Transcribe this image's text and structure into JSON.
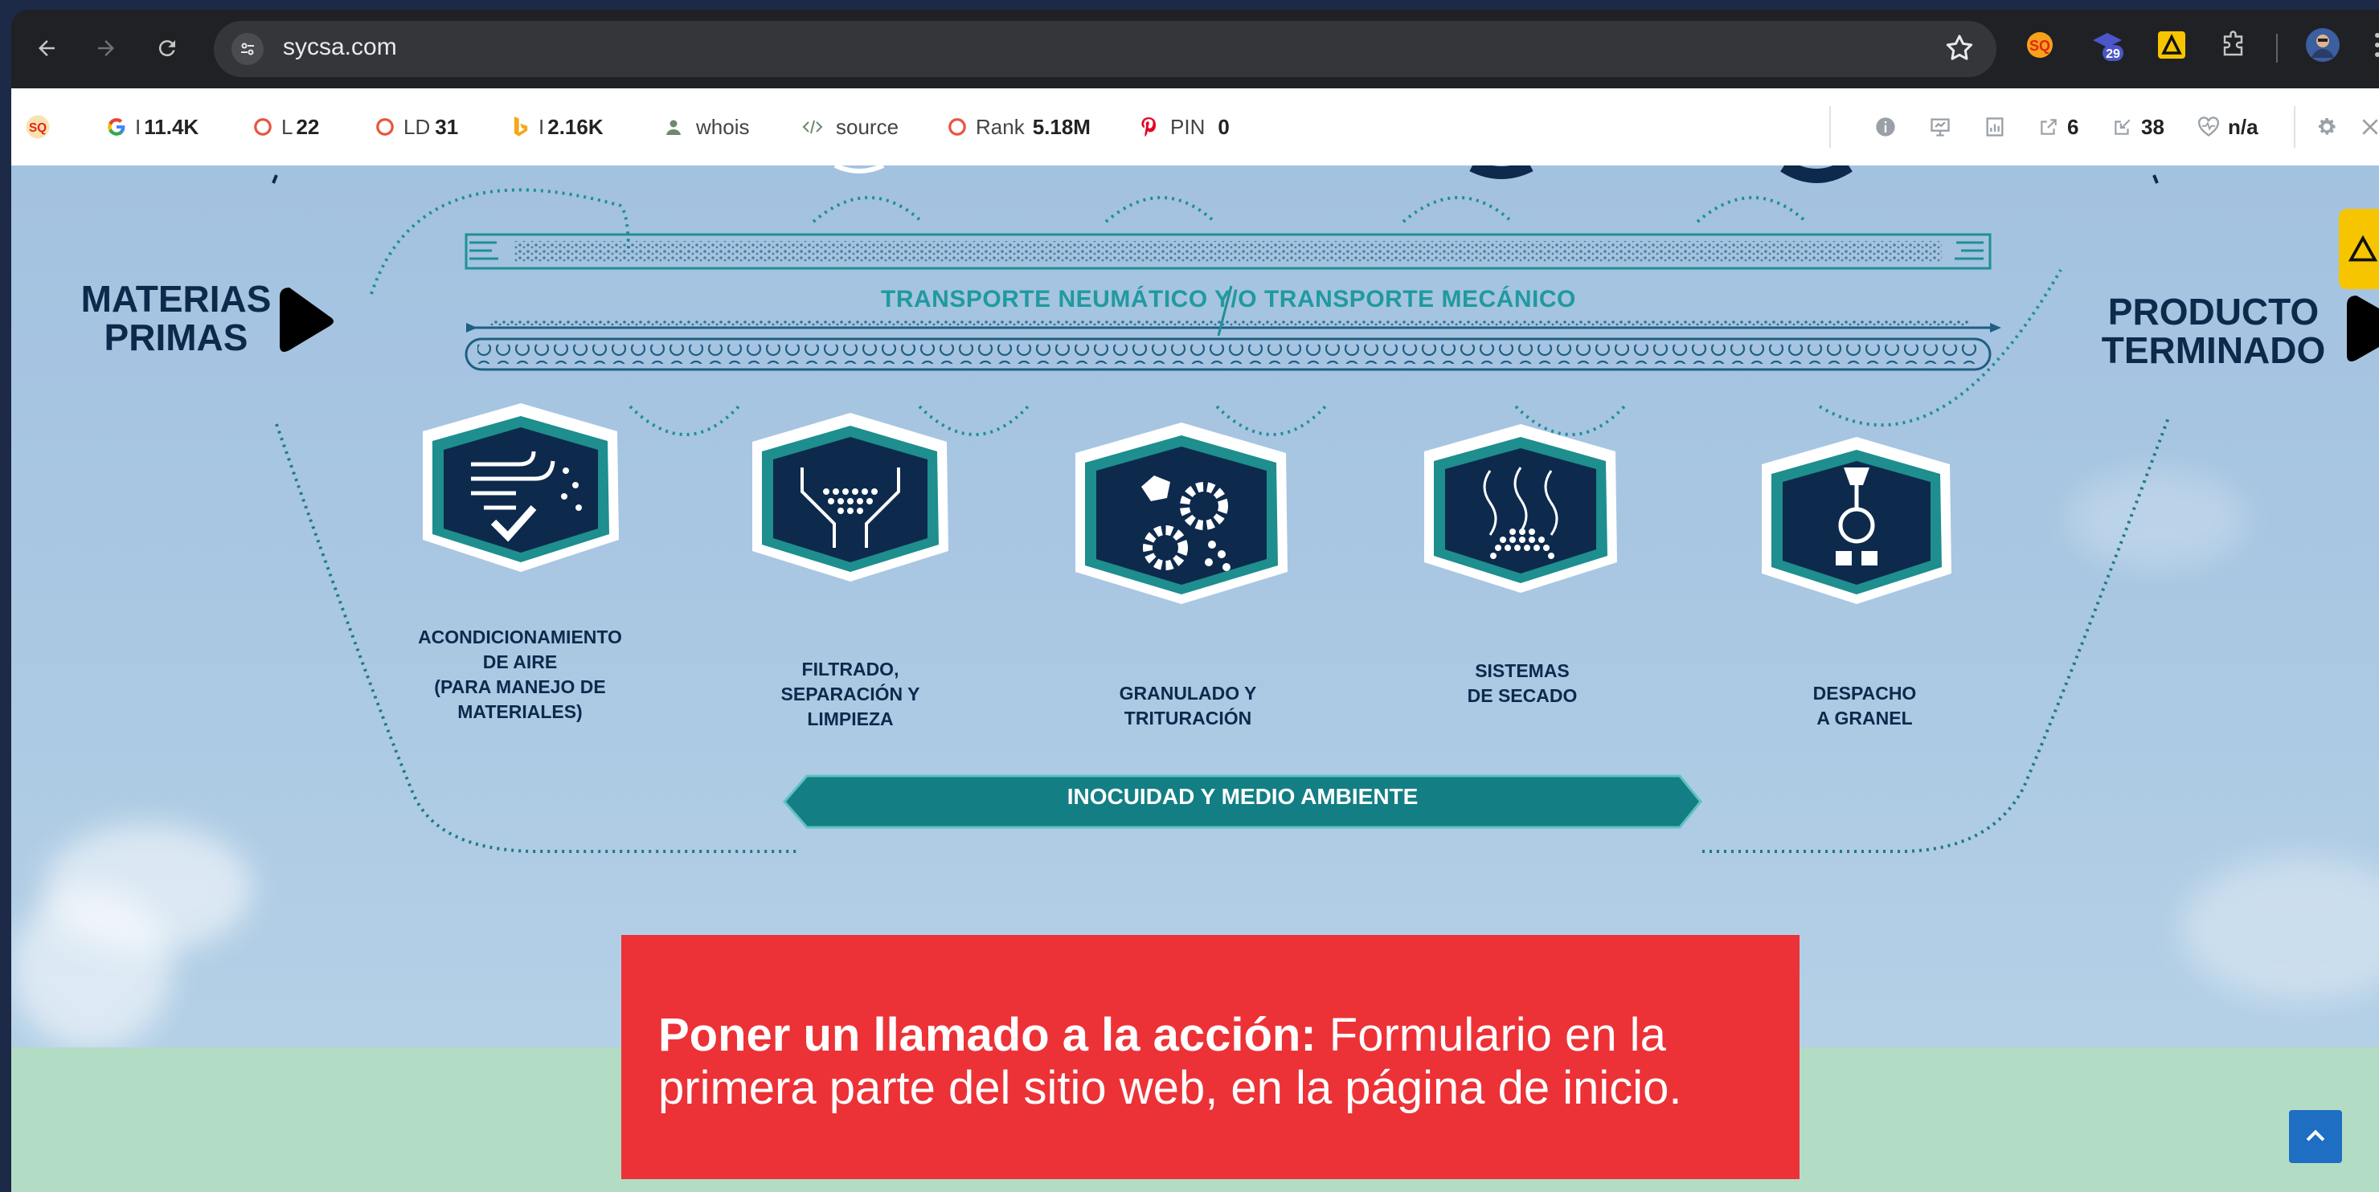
{
  "browser": {
    "url": "sycsa.com",
    "profile_badge": "29"
  },
  "seo_toolbar": {
    "google_index": "11.4K",
    "google_prefix": "I",
    "links_prefix": "L",
    "links": "22",
    "ld_prefix": "LD",
    "ld": "31",
    "bing_prefix": "I",
    "bing_index": "2.16K",
    "whois": "whois",
    "source": "source",
    "rank_label": "Rank",
    "rank": "5.18M",
    "pin_label": "PIN",
    "pin": "0",
    "external_links": "6",
    "internal_links": "38",
    "health": "n/a"
  },
  "diagram": {
    "left_label_1": "MATERIAS",
    "left_label_2": "PRIMAS",
    "right_label_1": "PRODUCTO",
    "right_label_2": "TERMINADO",
    "transport": "TRANSPORTE NEUMÁTICO Y/O TRANSPORTE MECÁNICO",
    "steps": [
      {
        "l1": "ACONDICIONAMIENTO",
        "l2": "DE AIRE",
        "l3": "(PARA MANEJO DE",
        "l4": "MATERIALES)",
        "icon": "air-conditioning-icon"
      },
      {
        "l1": "FILTRADO,",
        "l2": "SEPARACIÓN Y",
        "l3": "LIMPIEZA",
        "icon": "filter-icon"
      },
      {
        "l1": "GRANULADO Y",
        "l2": "TRITURACIÓN",
        "icon": "gears-icon"
      },
      {
        "l1": "SISTEMAS",
        "l2": "DE SECADO",
        "icon": "drying-icon"
      },
      {
        "l1": "DESPACHO",
        "l2": "A GRANEL",
        "icon": "bulk-dispatch-icon"
      }
    ],
    "banner": "INOCUIDAD Y MEDIO AMBIENTE"
  },
  "cta": {
    "bold": "Poner un llamado a la acción:",
    "text": " Formulario en la primera parte del sitio web, en la página de inicio."
  },
  "colors": {
    "navy": "#0d2a4d",
    "teal": "#1f9aa0",
    "red": "#ec3237",
    "sky": "#a9c7e2",
    "mint": "#b3dcc5"
  }
}
